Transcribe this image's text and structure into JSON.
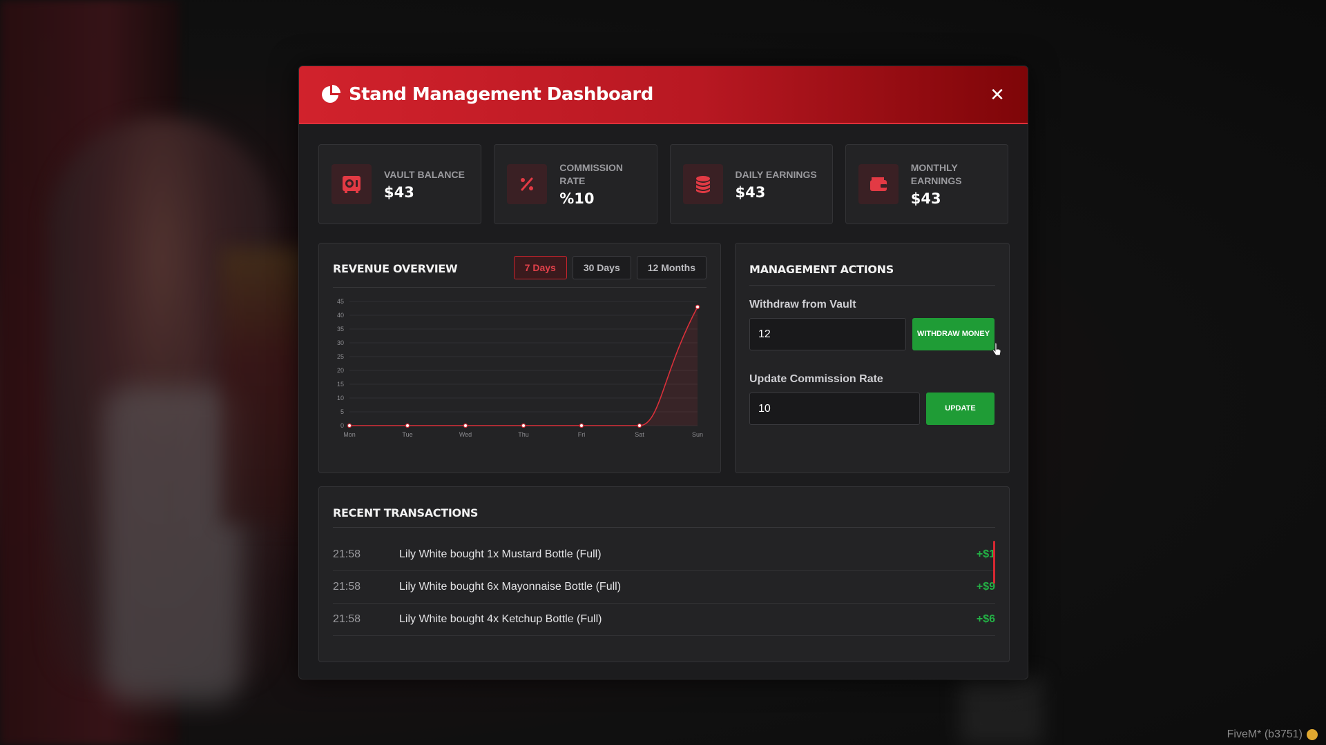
{
  "colors": {
    "accent": "#d1222c",
    "success": "#1f9c36",
    "panel": "#232325",
    "background": "#1c1c1e"
  },
  "header": {
    "title": "Stand Management Dashboard",
    "icon": "pie-chart-icon",
    "close_icon": "close-icon",
    "close_label": "✕"
  },
  "stats": [
    {
      "label": "VAULT BALANCE",
      "value": "$43",
      "icon": "vault-icon"
    },
    {
      "label": "COMMISSION RATE",
      "value": "%10",
      "icon": "percent-icon"
    },
    {
      "label": "DAILY EARNINGS",
      "value": "$43",
      "icon": "coins-icon"
    },
    {
      "label": "MONTHLY EARNINGS",
      "value": "$43",
      "icon": "wallet-icon"
    }
  ],
  "revenue": {
    "title": "REVENUE OVERVIEW",
    "tabs": [
      {
        "label": "7 Days",
        "active": true
      },
      {
        "label": "30 Days",
        "active": false
      },
      {
        "label": "12 Months",
        "active": false
      }
    ]
  },
  "chart_data": {
    "type": "line",
    "categories": [
      "Mon",
      "Tue",
      "Wed",
      "Thu",
      "Fri",
      "Sat",
      "Sun"
    ],
    "series": [
      {
        "values": [
          0,
          0,
          0,
          0,
          0,
          0,
          43
        ]
      }
    ],
    "ylim": [
      0,
      45
    ],
    "yticks": [
      0,
      5,
      10,
      15,
      20,
      25,
      30,
      35,
      40,
      45
    ],
    "grid": true,
    "color": "#d9303a"
  },
  "actions": {
    "title": "MANAGEMENT ACTIONS",
    "withdraw": {
      "label": "Withdraw from Vault",
      "value": "12",
      "button": "WITHDRAW MONEY"
    },
    "commission": {
      "label": "Update Commission Rate",
      "value": "10",
      "button": "UPDATE"
    }
  },
  "transactions": {
    "title": "RECENT TRANSACTIONS",
    "items": [
      {
        "time": "21:58",
        "description": "Lily White bought 1x Mustard Bottle (Full)",
        "amount": "+$1"
      },
      {
        "time": "21:58",
        "description": "Lily White bought 6x Mayonnaise Bottle (Full)",
        "amount": "+$9"
      },
      {
        "time": "21:58",
        "description": "Lily White bought 4x Ketchup Bottle (Full)",
        "amount": "+$6"
      }
    ]
  },
  "watermark": "FiveM* (b3751)"
}
